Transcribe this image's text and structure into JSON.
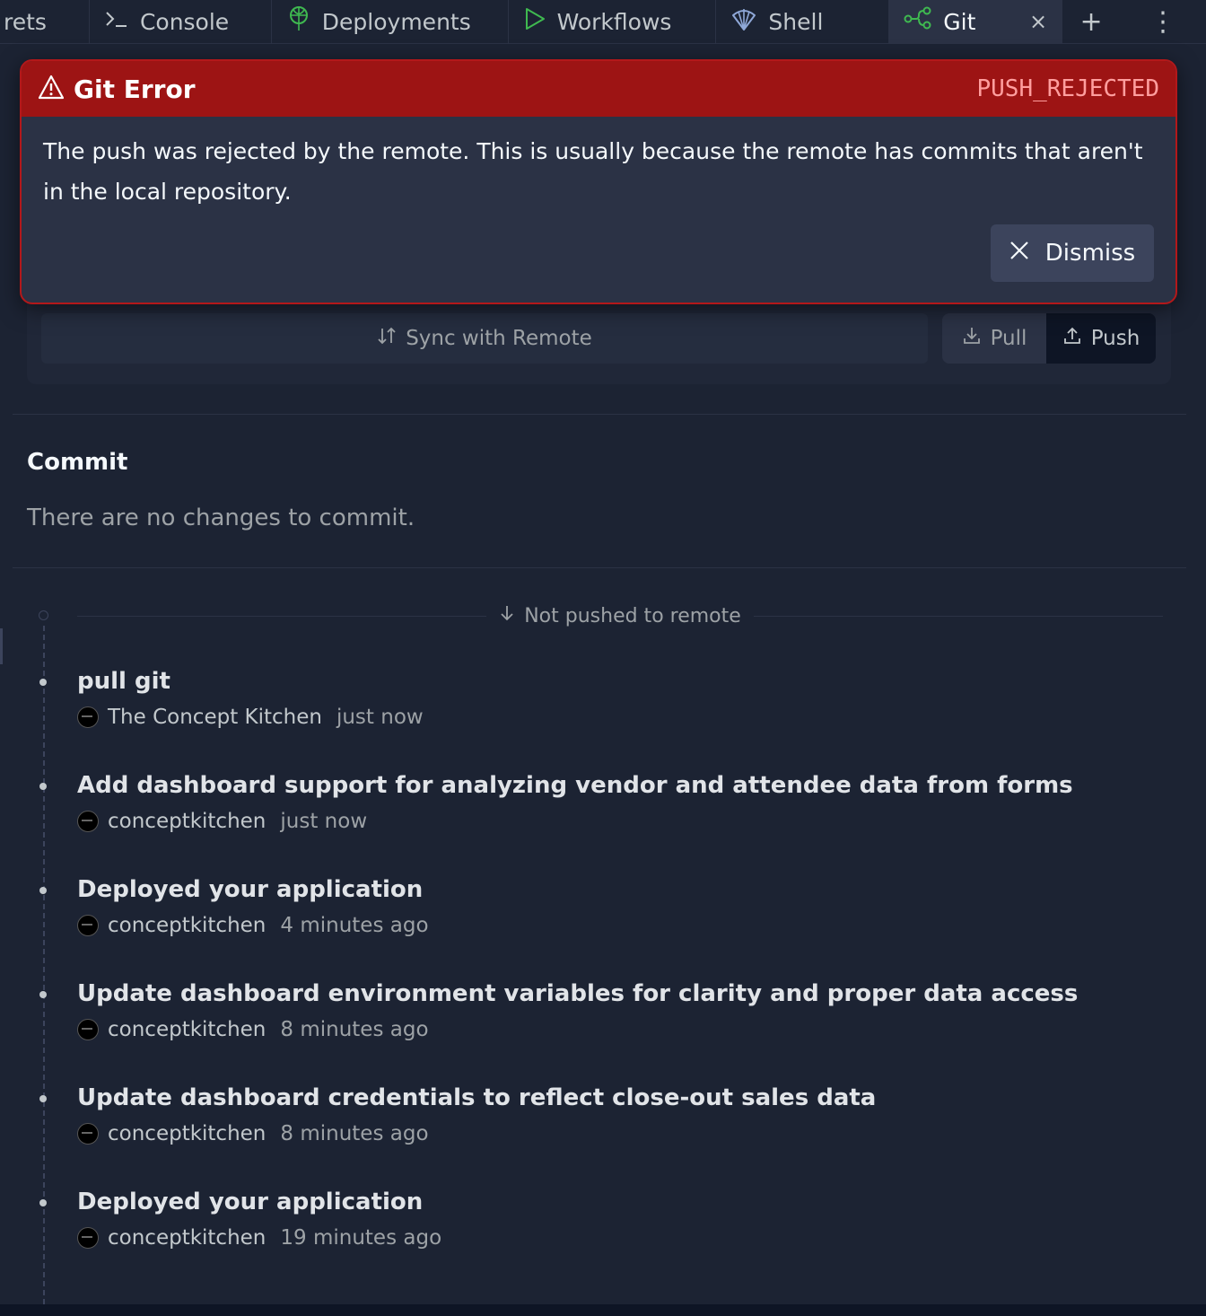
{
  "tabs": [
    {
      "label": "rets",
      "icon": "secrets-tab-partial"
    },
    {
      "label": "Console",
      "icon": "console-icon"
    },
    {
      "label": "Deployments",
      "icon": "deployments-icon"
    },
    {
      "label": "Workflows",
      "icon": "play-icon"
    },
    {
      "label": "Shell",
      "icon": "shell-icon"
    },
    {
      "label": "Git",
      "icon": "git-icon",
      "active": true
    }
  ],
  "tabbar": {
    "close_glyph": "×",
    "add_glyph": "+",
    "more_glyph": "⋮"
  },
  "git_error": {
    "title": "Git Error",
    "code": "PUSH_REJECTED",
    "message": "The push was rejected by the remote. This is usually because the remote has commits that aren't in the local repository.",
    "dismiss_label": "Dismiss"
  },
  "remote": {
    "sync_label": "Sync with Remote",
    "pull_label": "Pull",
    "push_label": "Push"
  },
  "commit": {
    "heading": "Commit",
    "empty_text": "There are no changes to commit."
  },
  "history": {
    "not_pushed_label": "Not pushed to remote",
    "commits": [
      {
        "title": "pull git",
        "author": "The Concept Kitchen",
        "time": "just now"
      },
      {
        "title": "Add dashboard support for analyzing vendor and attendee data from forms",
        "author": "conceptkitchen",
        "time": "just now"
      },
      {
        "title": "Deployed your application",
        "author": "conceptkitchen",
        "time": "4 minutes ago"
      },
      {
        "title": "Update dashboard environment variables for clarity and proper data access",
        "author": "conceptkitchen",
        "time": "8 minutes ago"
      },
      {
        "title": "Update dashboard credentials to reflect close-out sales data",
        "author": "conceptkitchen",
        "time": "8 minutes ago"
      },
      {
        "title": "Deployed your application",
        "author": "conceptkitchen",
        "time": "19 minutes ago"
      }
    ]
  },
  "colors": {
    "background": "#1c2333",
    "error_header": "#9d1414",
    "error_border": "#b3181a",
    "error_code": "#ff9e9e",
    "git_accent": "#3fb950"
  }
}
